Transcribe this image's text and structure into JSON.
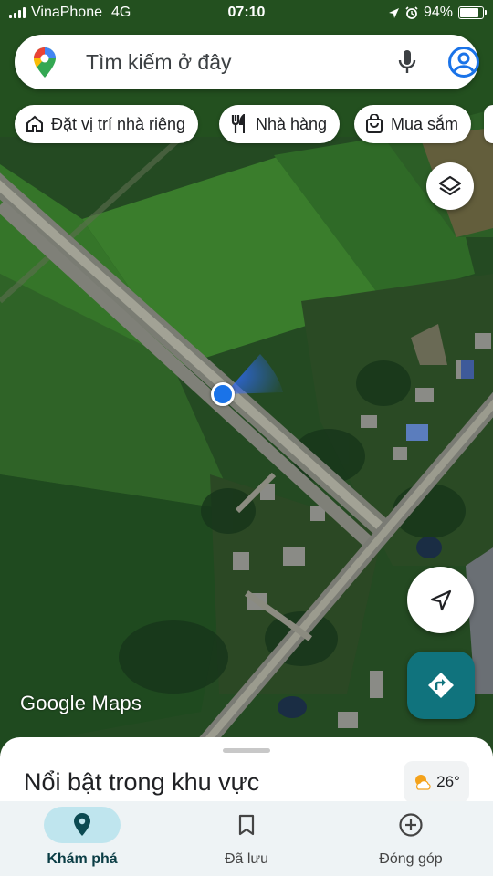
{
  "status_bar": {
    "carrier": "VinaPhone",
    "network": "4G",
    "time": "07:10",
    "battery": "94%",
    "battery_level": 0.94
  },
  "search": {
    "placeholder": "Tìm kiếm ở đây"
  },
  "chips": [
    {
      "label": "Đặt vị trí nhà riêng",
      "icon": "home-icon"
    },
    {
      "label": "Nhà hàng",
      "icon": "restaurant-icon"
    },
    {
      "label": "Mua sắm",
      "icon": "shopping-bag-icon"
    }
  ],
  "map": {
    "watermark": "Google Maps"
  },
  "sheet": {
    "title": "Nổi bật trong khu vực",
    "weather_temp": "26°"
  },
  "nav": [
    {
      "label": "Khám phá",
      "icon": "explore-pin-icon",
      "active": true
    },
    {
      "label": "Đã lưu",
      "icon": "bookmark-icon",
      "active": false
    },
    {
      "label": "Đóng góp",
      "icon": "add-circle-icon",
      "active": false
    }
  ],
  "colors": {
    "accent": "#10737d",
    "location_dot": "#1a73e8",
    "nav_active_bg": "#bfe5ee"
  }
}
